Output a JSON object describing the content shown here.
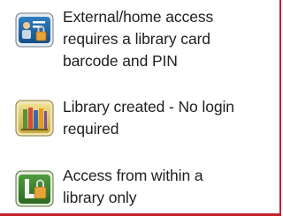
{
  "legend": {
    "items": [
      {
        "label": "External/home access\nrequires a library card\nbarcode and PIN",
        "icon": "library-card-lock-icon"
      },
      {
        "label": "Library created - No login\nrequired",
        "icon": "book-shelf-icon"
      },
      {
        "label": "Access from within a\nlibrary only",
        "icon": "library-lock-icon"
      }
    ]
  },
  "colors": {
    "border": "#c8202a",
    "text": "#1f1f1f"
  }
}
